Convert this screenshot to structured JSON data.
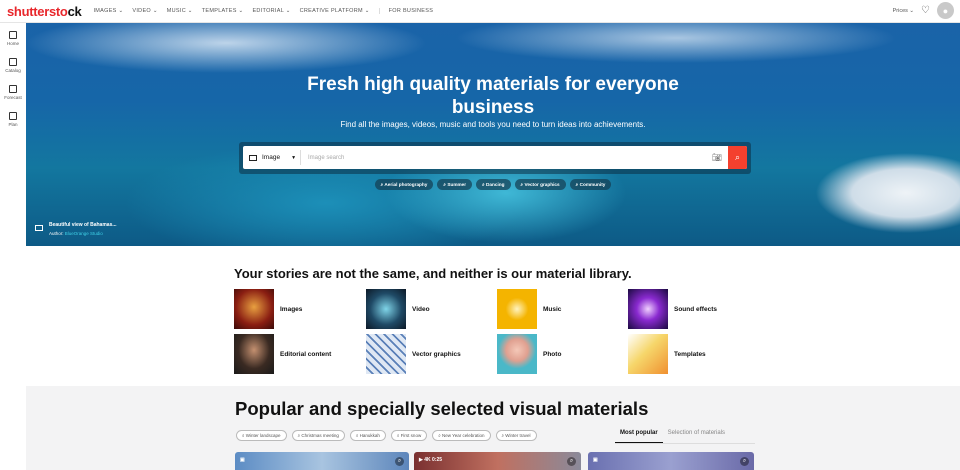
{
  "nav": {
    "logo_a": "shutterst",
    "logo_b": "ck",
    "logo_o": "o",
    "items": [
      "IMAGES ⌄",
      "VIDEO ⌄",
      "MUSIC ⌄",
      "TEMPLATES ⌄",
      "EDITORIAL ⌄",
      "CREATIVE PLATFORM ⌄",
      "FOR BUSINESS"
    ],
    "prices": "Prices ⌄"
  },
  "sidebar": [
    "Home",
    "Catalog",
    "Forecast",
    "Plan"
  ],
  "hero": {
    "title": "Fresh high quality materials for everyone business",
    "subtitle": "Find all the images, videos, music and tools you need to turn ideas into achievements.",
    "search_type": "Image",
    "search_placeholder": "Image search",
    "chips": [
      "Aerial photography",
      "Summer",
      "Dancing",
      "Vector graphics",
      "Community"
    ],
    "credit_title": "Beautiful view of Bahamas...",
    "credit_author_label": "Author:",
    "credit_author": "BlueOrange Studio"
  },
  "library": {
    "title": "Your stories are not the same, and neither is our material library.",
    "categories": [
      "Images",
      "Video",
      "Music",
      "Sound effects",
      "Editorial content",
      "Vector graphics",
      "Photo",
      "Templates"
    ]
  },
  "popular": {
    "title": "Popular and specially selected visual materials",
    "tags": [
      "Winter landscape",
      "Christmas meeting",
      "Hanukkah",
      "First snow",
      "New Year celebration",
      "Winter travel"
    ],
    "tabs": [
      "Most popular",
      "Selection of materials"
    ],
    "video_badge": "4K 0:25"
  }
}
